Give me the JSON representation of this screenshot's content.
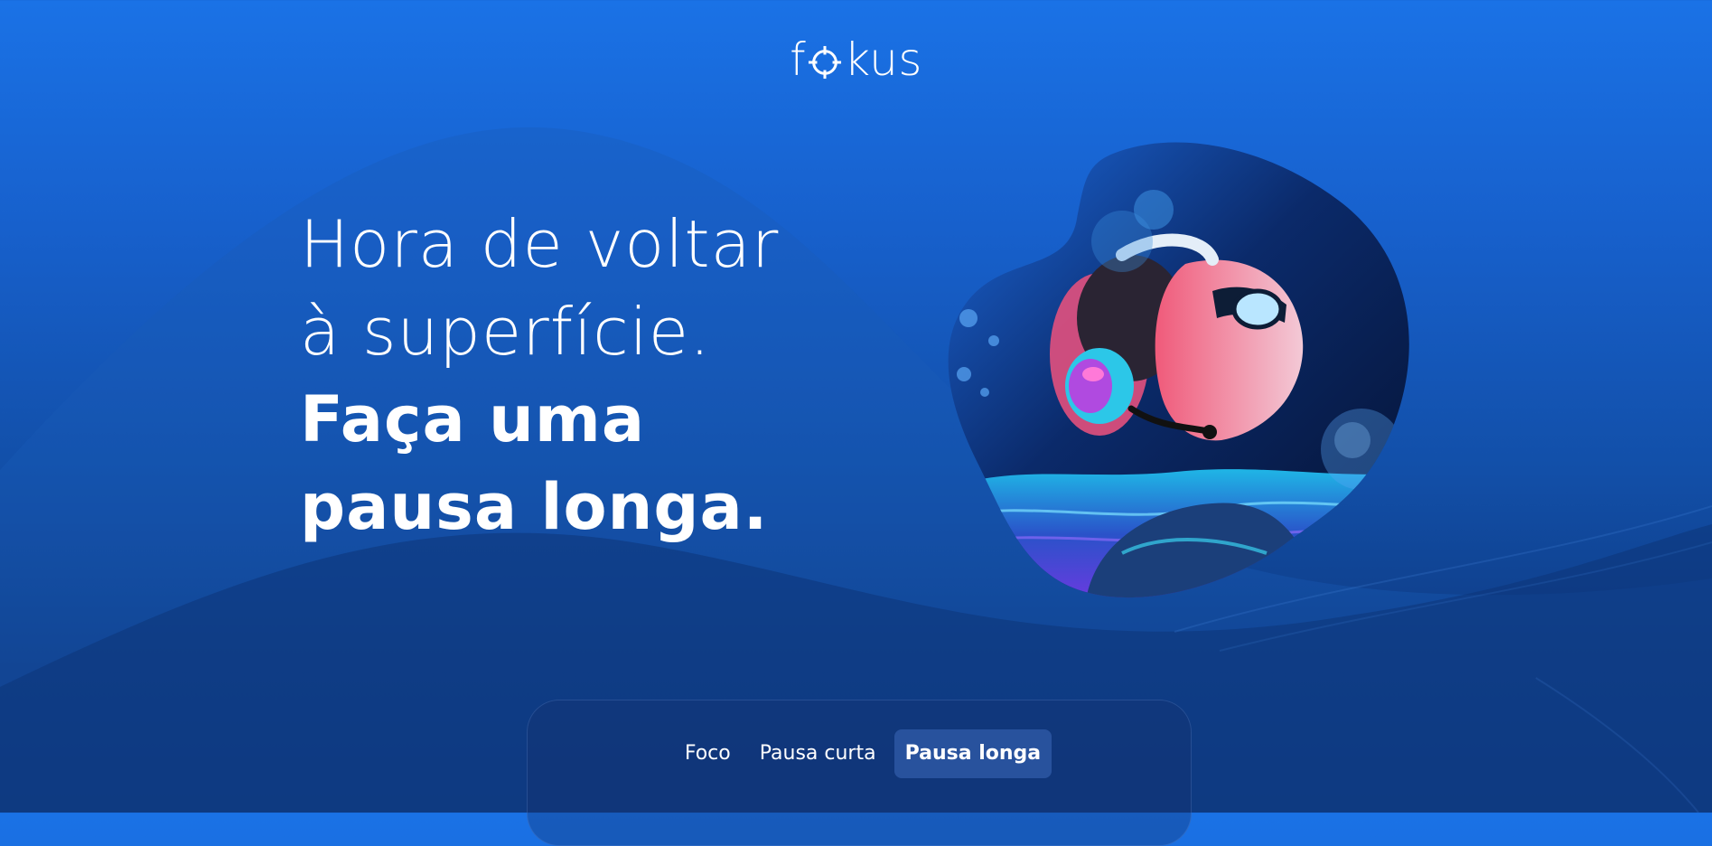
{
  "brand": {
    "logo_prefix": "f",
    "logo_suffix": "kus",
    "logo_icon": "target-o-icon"
  },
  "hero": {
    "line1": "Hora de voltar",
    "line2": "à superfície.",
    "line3": "Faça uma",
    "line4": "pausa longa."
  },
  "illustration": {
    "icon": "diver-with-headphones-illustration"
  },
  "tabs": [
    {
      "label": "Foco",
      "active": false
    },
    {
      "label": "Pausa curta",
      "active": false
    },
    {
      "label": "Pausa longa",
      "active": true
    }
  ],
  "colors": {
    "background_top": "#1a72e6",
    "background_bottom": "#0b3276",
    "text": "#ffffff",
    "active_tab": "#3c69b9"
  }
}
